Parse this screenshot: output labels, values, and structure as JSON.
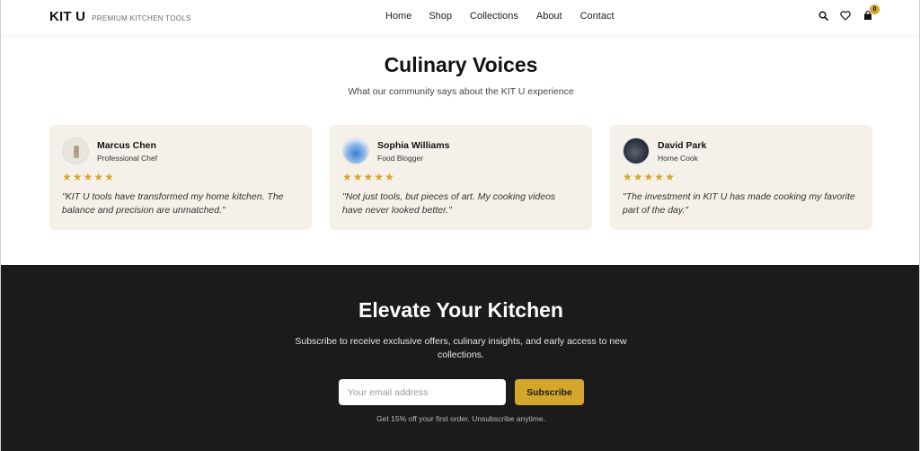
{
  "header": {
    "brand_name": "KIT U",
    "brand_tagline": "PREMIUM KITCHEN TOOLS",
    "nav": [
      "Home",
      "Shop",
      "Collections",
      "About",
      "Contact"
    ],
    "cart_count": "0",
    "icons": [
      "search-icon",
      "heart-icon",
      "cart-icon"
    ]
  },
  "testimonials": {
    "title": "Culinary Voices",
    "subtitle": "What our community says about the KIT U experience",
    "items": [
      {
        "name": "Marcus Chen",
        "role": "Professional Chef",
        "rating": 5,
        "quote": "\"KIT U tools have transformed my home kitchen. The balance and precision are unmatched.\""
      },
      {
        "name": "Sophia Williams",
        "role": "Food Blogger",
        "rating": 5,
        "quote": "\"Not just tools, but pieces of art. My cooking videos have never looked better.\""
      },
      {
        "name": "David Park",
        "role": "Home Cook",
        "rating": 5,
        "quote": "\"The investment in KIT U has made cooking my favorite part of the day.\""
      }
    ]
  },
  "newsletter": {
    "title": "Elevate Your Kitchen",
    "text": "Subscribe to receive exclusive offers, culinary insights, and early access to new collections.",
    "input_placeholder": "Your email address",
    "button_label": "Subscribe",
    "note": "Get 15% off your first order. Unsubscribe anytime."
  },
  "colors": {
    "accent": "#d4a72c",
    "card_bg": "#f5f1ea",
    "dark_bg": "#1b1b1b"
  }
}
